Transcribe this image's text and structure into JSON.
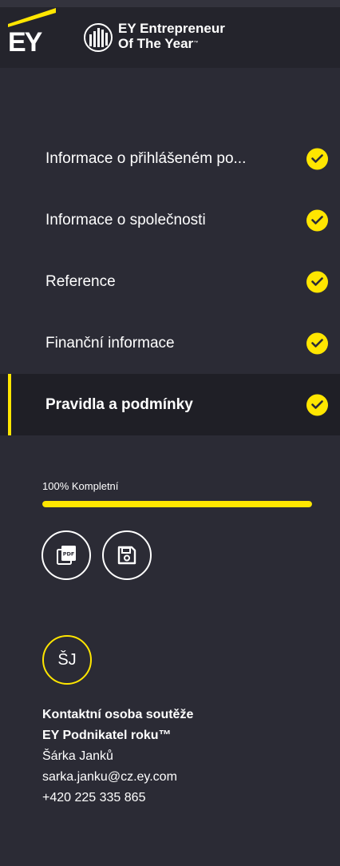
{
  "header": {
    "ey_logo_text": "EY",
    "program_line1": "EY Entrepreneur",
    "program_line2": "Of The Year",
    "trademark": "™"
  },
  "menu": {
    "items": [
      {
        "label": "Informace o přihlášeném po...",
        "status": "check-circle-icon",
        "active": false
      },
      {
        "label": "Informace o společnosti",
        "status": "check-circle-icon",
        "active": false
      },
      {
        "label": "Reference",
        "status": "check-circle-icon",
        "active": false
      },
      {
        "label": "Finanční informace",
        "status": "check-circle-icon",
        "active": false
      },
      {
        "label": "Pravidla a podmínky",
        "status": "check-circle-icon",
        "active": true
      }
    ]
  },
  "progress": {
    "label": "100% Kompletní",
    "value": 1.0
  },
  "actions": {
    "pdf_icon": "pdf-icon",
    "save_icon": "save-icon"
  },
  "contact": {
    "initials": "ŠJ",
    "title_line1": "Kontaktní osoba soutěže",
    "title_line2": "EY Podnikatel roku™",
    "name": "Šárka Janků",
    "email": "sarka.janku@cz.ey.com",
    "phone": "+420 225 335 865"
  },
  "colors": {
    "accent": "#ffe600",
    "background": "#2b2b35",
    "header_background": "#24242c",
    "active_item_background": "#1f1f26",
    "text": "#ffffff"
  }
}
